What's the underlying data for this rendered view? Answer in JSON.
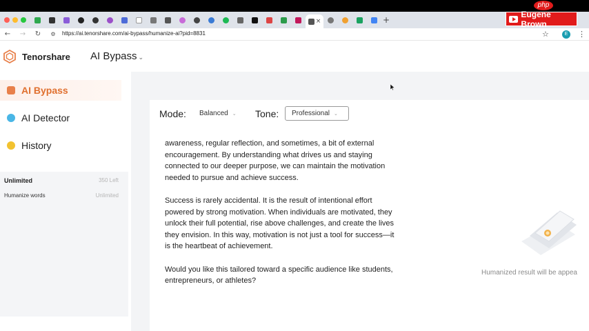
{
  "browser": {
    "url": "https://ai.tenorshare.com/ai-bypass/humanize-ai?pid=8831",
    "profile_initial": "E",
    "tab_close": "×",
    "new_tab": "+"
  },
  "overlay": {
    "php_badge": "php",
    "channel_name": "Eugene Brown"
  },
  "header": {
    "brand": "Tenorshare",
    "product": "AI Bypass",
    "product_caret": "⌄"
  },
  "sidebar": {
    "items": [
      {
        "label": "AI Bypass",
        "icon": "bypass-icon",
        "color": "#e8804a"
      },
      {
        "label": "AI Detector",
        "icon": "detector-icon",
        "color": "#49b6e6"
      },
      {
        "label": "History",
        "icon": "history-icon",
        "color": "#f2c230"
      }
    ],
    "usage": {
      "title": "Unlimited",
      "left": "350 Left",
      "label": "Humanize words",
      "value": "Unlimited"
    }
  },
  "editor": {
    "mode_label": "Mode:",
    "mode_value": "Balanced",
    "tone_label": "Tone:",
    "tone_value": "Professional",
    "paragraphs": [
      "awareness, regular reflection, and sometimes, a bit of external encouragement. By understanding what drives us and staying connected to our deeper purpose, we can maintain the motivation needed to pursue and achieve success.",
      "Success is rarely accidental. It is the result of intentional effort powered by strong motivation. When individuals are motivated, they unlock their full potential, rise above challenges, and create the lives they envision. In this way, motivation is not just a tool for success—it is the heartbeat of achievement.",
      "Would you like this tailored toward a specific audience like students, entrepreneurs, or athletes?"
    ]
  },
  "result": {
    "placeholder": "Humanized result will be appea"
  },
  "colors": {
    "accent": "#e0702f",
    "main_bg": "#f3f4f6"
  }
}
